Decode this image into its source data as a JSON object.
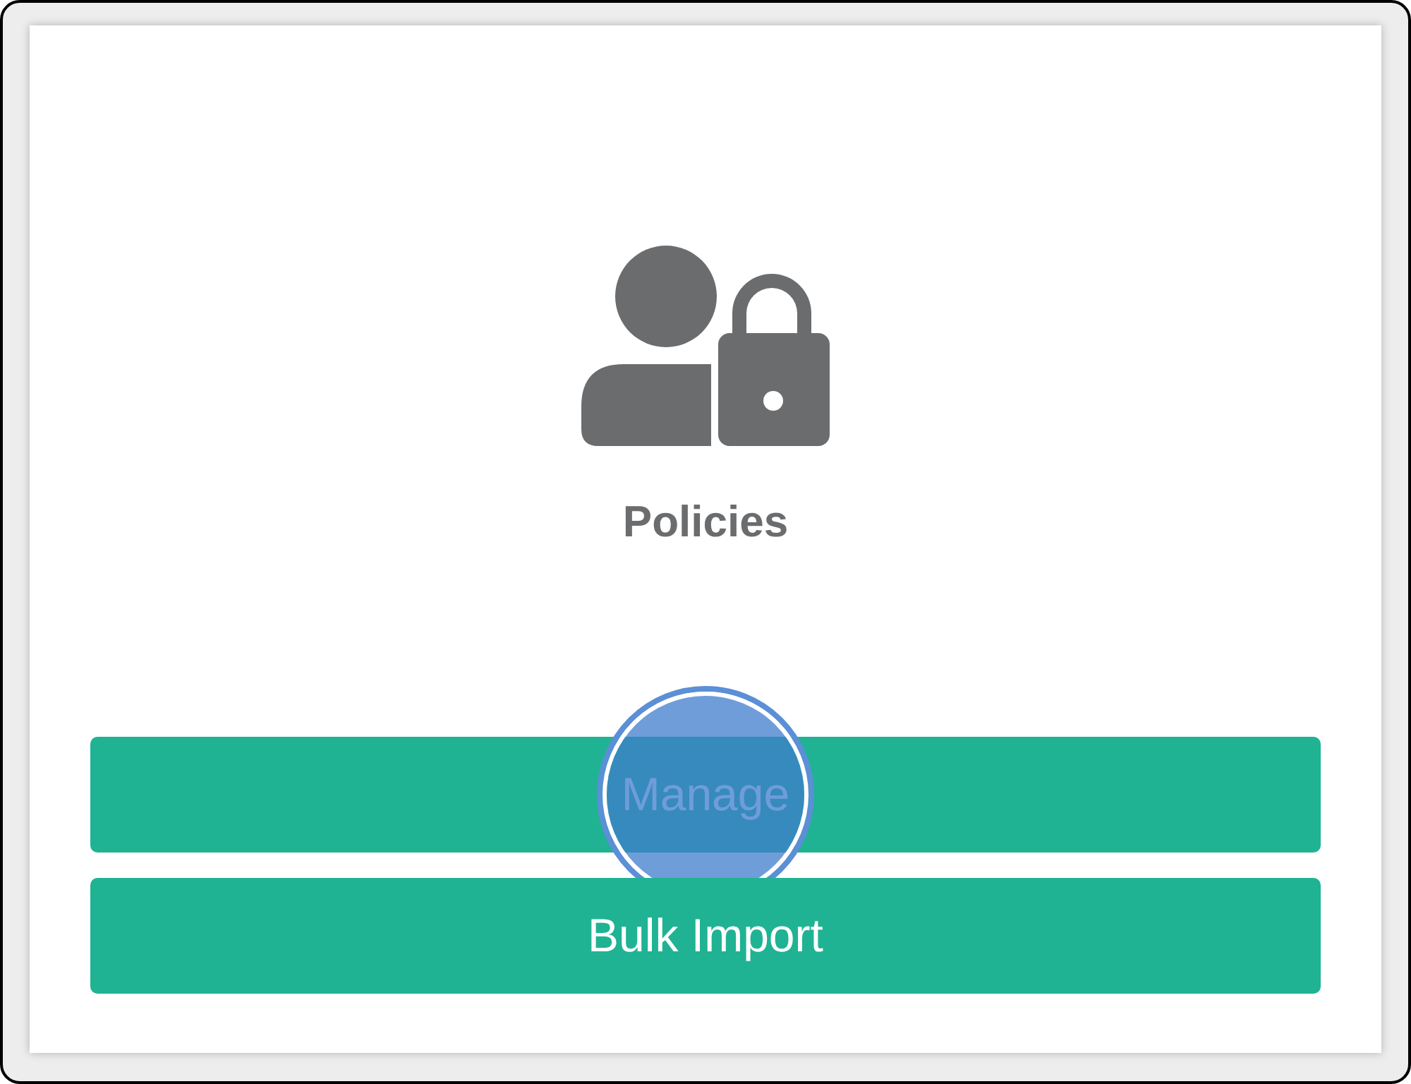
{
  "card": {
    "title": "Policies"
  },
  "buttons": [
    {
      "label": "Manage",
      "pressed": true
    },
    {
      "label": "Bulk Import",
      "pressed": false
    }
  ]
}
